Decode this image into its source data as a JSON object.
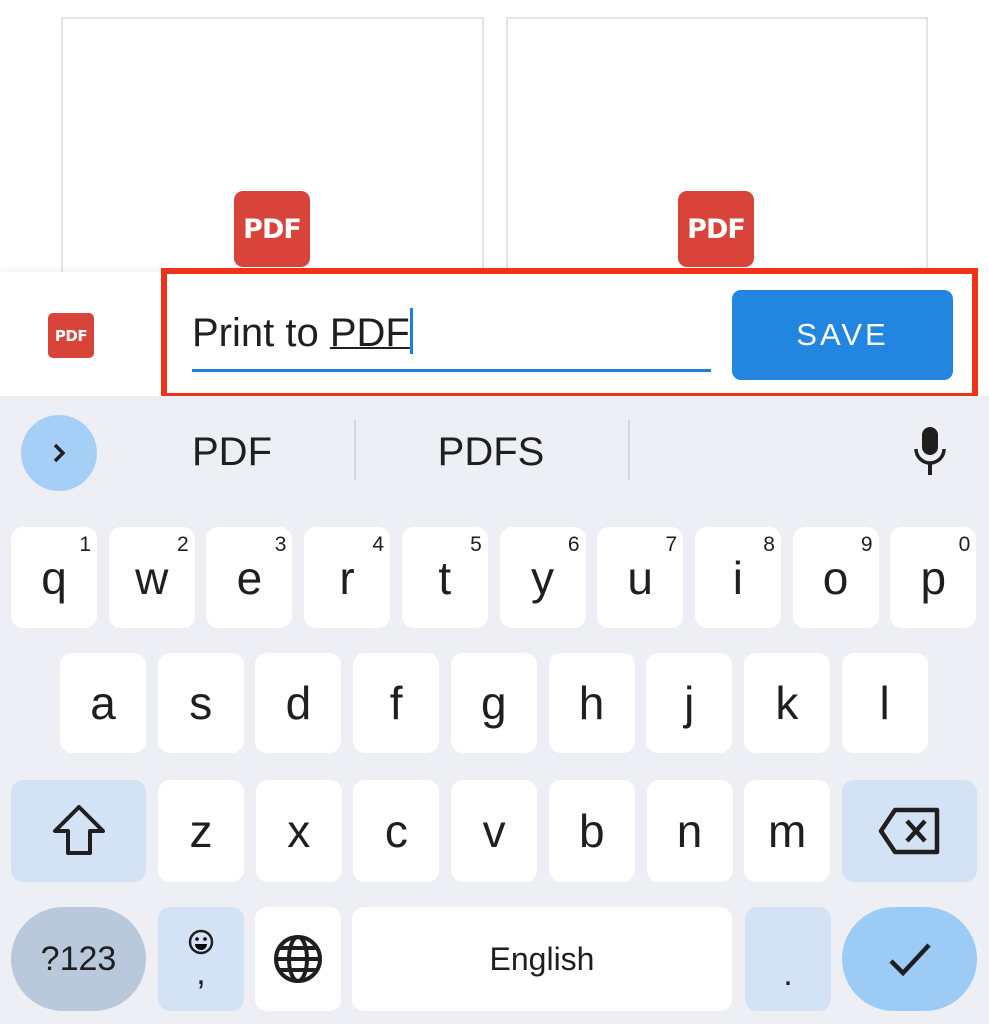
{
  "thumbnails": [
    {
      "icon": "PDF"
    },
    {
      "icon": "PDF"
    }
  ],
  "save_sheet": {
    "app_icon": "PDF",
    "filename_value": "Print to ",
    "filename_composing": "PDF",
    "save_label": "SAVE",
    "highlight_color": "#ee3418",
    "accent": "#2286e0"
  },
  "keyboard": {
    "suggestions": [
      "PDF",
      "PDFS"
    ],
    "row1": [
      [
        "q",
        "1"
      ],
      [
        "w",
        "2"
      ],
      [
        "e",
        "3"
      ],
      [
        "r",
        "4"
      ],
      [
        "t",
        "5"
      ],
      [
        "y",
        "6"
      ],
      [
        "u",
        "7"
      ],
      [
        "i",
        "8"
      ],
      [
        "o",
        "9"
      ],
      [
        "p",
        "0"
      ]
    ],
    "row2": [
      "a",
      "s",
      "d",
      "f",
      "g",
      "h",
      "j",
      "k",
      "l"
    ],
    "row3": [
      "z",
      "x",
      "c",
      "v",
      "b",
      "n",
      "m"
    ],
    "symbols_label": "?123",
    "comma": ",",
    "space_label": "English",
    "period": "."
  }
}
